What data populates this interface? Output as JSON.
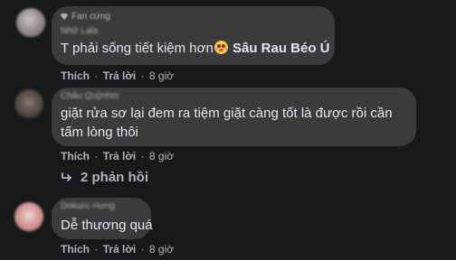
{
  "comments": [
    {
      "badge_icon": "diamond-icon",
      "badge_label": "Fan cứng",
      "author": "Nhữ Lala",
      "text_before": "T phải sống tiết kiệm hơn",
      "emoji": "flushed-face-emoji",
      "mention": "Sâu Rau Béo Ú",
      "like_label": "Thích",
      "reply_label": "Trả lời",
      "time": "8 giờ"
    },
    {
      "author": "Châu Quỳnhm",
      "text_line1": "giặt rửa sơ lại đem ra tiệm giặt càng tốt là được rồi cần",
      "text_line2": "tấm lòng thôi",
      "like_label": "Thích",
      "reply_label": "Trả lời",
      "time": "8 giờ",
      "replies_icon": "reply-arrow-icon",
      "replies_label": "2 phản hồi"
    },
    {
      "author": "Dokuro Hưng",
      "text": "Dễ thương quá",
      "like_label": "Thích",
      "reply_label": "Trả lời",
      "time": "8 giờ"
    }
  ],
  "colors": {
    "background": "#18191a",
    "bubble": "#3a3b3c",
    "primary_text": "#e4e6eb",
    "secondary_text": "#b0b3b8"
  }
}
